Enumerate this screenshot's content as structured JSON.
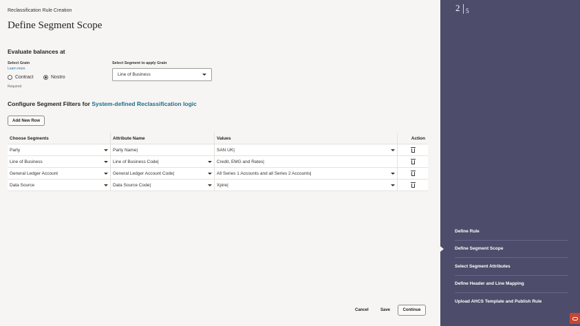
{
  "header": {
    "breadcrumb": "Reclassification Rule Creation",
    "title": "Define Segment Scope"
  },
  "evaluate": {
    "heading": "Evaluate balances at",
    "grain_label": "Select Grain",
    "learn_more": "Learn more",
    "options": [
      "Contract",
      "Nostro"
    ],
    "selected": "Nostro",
    "required_text": "Required",
    "segment_label": "Select Segment to apply Grain",
    "segment_value": "Line of Business"
  },
  "filters": {
    "heading_prefix": "Configure Segment Filters for ",
    "heading_accent": "System-defined Reclassification logic",
    "add_row_label": "Add New Row",
    "columns": [
      "Choose Segments",
      "Attribute Name",
      "Values",
      "Action"
    ],
    "rows": [
      {
        "segment": "Party",
        "attribute": "Party Name|",
        "value": "SAN UK|"
      },
      {
        "segment": "Line of Business",
        "attribute": "Line of Business Code|",
        "value": "Credit, EMG and Rates|"
      },
      {
        "segment": "General Ledger Account",
        "attribute": "General Ledger Account Code|",
        "value": "All Series 1 Accounts and all Series 2 Accounts|"
      },
      {
        "segment": "Data Source",
        "attribute": "Data Source Code|",
        "value": "Xpire|"
      }
    ]
  },
  "footer": {
    "cancel": "Cancel",
    "save": "Save",
    "continue": "Continue"
  },
  "progress": {
    "current": "2",
    "total": "5"
  },
  "steps": [
    "Define Rule",
    "Define Segment Scope",
    "Select Segment Attributes",
    "Define Header and Line Mapping",
    "Upload AHCS Template and Publish Rule"
  ],
  "colors": {
    "sidebar": "#4d4c6b",
    "accent": "#1a6f8a",
    "brand": "#c74634"
  }
}
